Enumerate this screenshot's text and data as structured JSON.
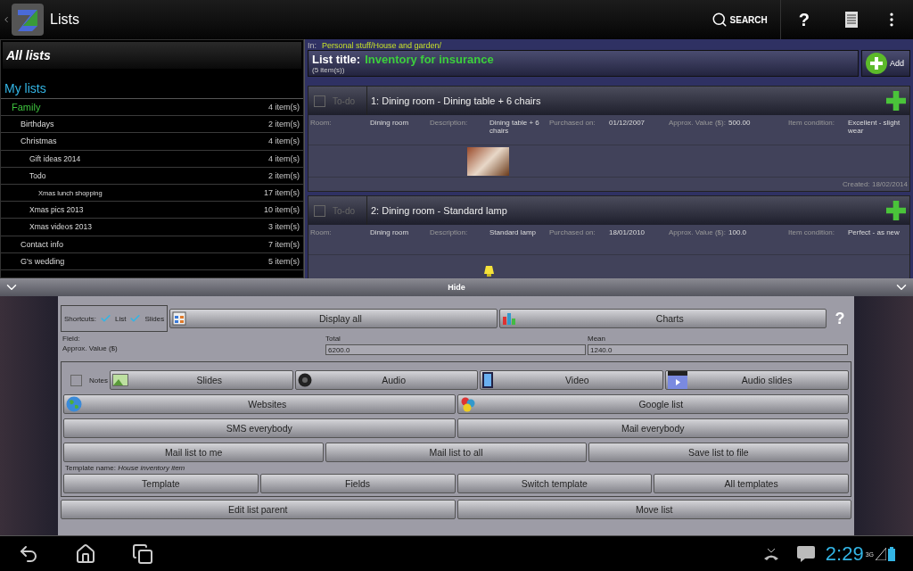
{
  "app_bar": {
    "title": "Lists",
    "search_label": "SEARCH",
    "help_label": "?"
  },
  "sidebar": {
    "title": "All lists",
    "section": "My lists",
    "items": [
      {
        "label": "Family",
        "count": "4 item(s)",
        "selected": true,
        "children": [
          {
            "label": "Birthdays",
            "count": "2 item(s)",
            "selected": false
          },
          {
            "label": "Christmas",
            "count": "4 item(s)",
            "selected": false,
            "children": [
              {
                "label": "Gift ideas 2014",
                "count": "4 item(s)",
                "selected": false
              },
              {
                "label": "Todo",
                "count": "2 item(s)",
                "selected": false,
                "children": [
                  {
                    "label": "Xmas lunch shopping",
                    "count": "17 item(s)",
                    "selected": false
                  }
                ]
              },
              {
                "label": "Xmas pics 2013",
                "count": "10 item(s)",
                "selected": false
              },
              {
                "label": "Xmas videos 2013",
                "count": "3 item(s)",
                "selected": false
              }
            ]
          },
          {
            "label": "Contact info",
            "count": "7 item(s)",
            "selected": false
          },
          {
            "label": "G's wedding",
            "count": "5 item(s)",
            "selected": false
          }
        ]
      }
    ]
  },
  "list": {
    "path_label": "In:",
    "path": "Personal stuff/House and garden/",
    "title_label": "List title:",
    "title": "Inventory for insurance",
    "count": "(5 item(s))",
    "add_label": "Add",
    "items": [
      {
        "todo_label": "To-do",
        "checked": false,
        "title": "1: Dining room -  Dining table + 6 chairs",
        "fields": [
          {
            "label": "Room:",
            "value": "Dining room"
          },
          {
            "label": "Description:",
            "value": "Dining table + 6 chairs"
          },
          {
            "label": "Purchased on:",
            "value": "01/12/2007"
          },
          {
            "label": "Approx. Value ($):",
            "value": "500.00"
          },
          {
            "label": "Item condition:",
            "value": "Excellent - slight wear"
          }
        ],
        "created": "Created: 18/02/2014"
      },
      {
        "todo_label": "To-do",
        "checked": false,
        "title": "2: Dining room -  Standard lamp",
        "fields": [
          {
            "label": "Room:",
            "value": "Dining room"
          },
          {
            "label": "Description:",
            "value": "Standard lamp"
          },
          {
            "label": "Purchased on:",
            "value": "18/01/2010"
          },
          {
            "label": "Approx. Value ($):",
            "value": "100.0"
          },
          {
            "label": "Item condition:",
            "value": "Perfect - as new"
          }
        ]
      }
    ]
  },
  "hide_bar": {
    "label": "Hide"
  },
  "panel": {
    "shortcuts": {
      "label": "Shortcuts:",
      "options": [
        {
          "label": "List",
          "checked": true
        },
        {
          "label": "Slides",
          "checked": true
        }
      ]
    },
    "top_buttons": [
      {
        "label": "Display all"
      },
      {
        "label": "Charts"
      }
    ],
    "help": "?",
    "stats": {
      "field_label": "Field:",
      "columns": [
        "Total",
        "Mean"
      ],
      "row_label": "Approx. Value ($)",
      "values": [
        "6200.0",
        "1240.0"
      ]
    },
    "notes": {
      "label": "Notes",
      "checked": false
    },
    "media_buttons": [
      {
        "label": "Slides"
      },
      {
        "label": "Audio"
      },
      {
        "label": "Video"
      },
      {
        "label": "Audio slides"
      }
    ],
    "button_rows": [
      [
        {
          "label": "Websites"
        },
        {
          "label": "Google list"
        }
      ],
      [
        {
          "label": "SMS everybody"
        },
        {
          "label": "Mail everybody"
        }
      ],
      [
        {
          "label": "Mail list to me"
        },
        {
          "label": "Mail list to all"
        },
        {
          "label": "Save list to file"
        }
      ]
    ],
    "template_text": "Template name: *House inventory item*",
    "template_buttons": [
      {
        "label": "Template"
      },
      {
        "label": "Fields"
      },
      {
        "label": "Switch template"
      },
      {
        "label": "All templates"
      }
    ],
    "bottom_buttons": [
      {
        "label": "Edit list parent"
      },
      {
        "label": "Move list"
      }
    ]
  },
  "status_bar": {
    "time": "2:29",
    "network": "3G"
  }
}
